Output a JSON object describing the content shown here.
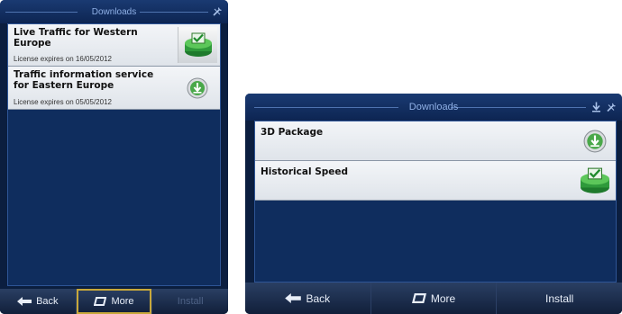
{
  "left_screen": {
    "title": "Downloads",
    "items": [
      {
        "name": "Live Traffic for Western Europe",
        "license": "License expires on 16/05/2012",
        "icon": "installed-check-icon"
      },
      {
        "name": "Traffic information service for Eastern Europe",
        "license": "License expires on 05/05/2012",
        "icon": "download-icon"
      }
    ],
    "buttons": {
      "back": "Back",
      "more": "More",
      "install": "Install"
    }
  },
  "right_screen": {
    "title": "Downloads",
    "items": [
      {
        "name": "3D Package",
        "icon": "download-icon"
      },
      {
        "name": "Historical Speed",
        "icon": "installed-check-icon"
      }
    ],
    "buttons": {
      "back": "Back",
      "more": "More",
      "install": "Install"
    }
  },
  "colors": {
    "background": "#0b1e3f",
    "title_text": "#8fb0e6",
    "item_bg": "#e6eaef",
    "highlight_border": "#c8a83a",
    "disabled_text": "#4e6286"
  }
}
